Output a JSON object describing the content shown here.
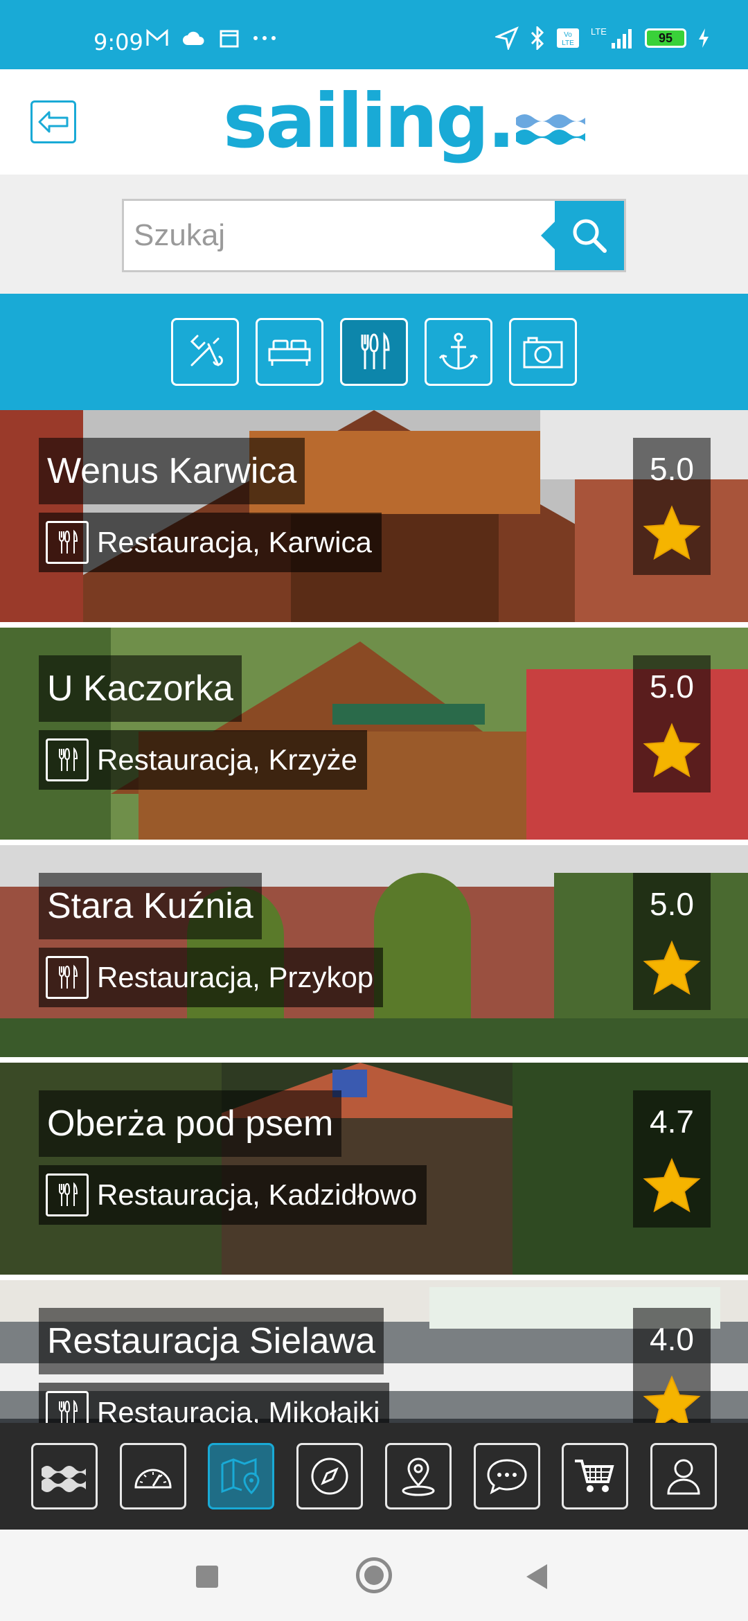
{
  "status": {
    "time": "9:09",
    "battery": "95",
    "network": "LTE",
    "volte": "Vo LTE"
  },
  "header": {
    "logo": "sailing."
  },
  "search": {
    "placeholder": "Szukaj"
  },
  "categories": [
    {
      "icon": "tools-icon",
      "active": false
    },
    {
      "icon": "bed-icon",
      "active": false
    },
    {
      "icon": "cutlery-icon",
      "active": true
    },
    {
      "icon": "anchor-icon",
      "active": false
    },
    {
      "icon": "camera-icon",
      "active": false
    }
  ],
  "places": [
    {
      "name": "Wenus Karwica",
      "subtitle": "Restauracja, Karwica",
      "rating": "5.0",
      "theme": "#7a3b22"
    },
    {
      "name": "U Kaczorka",
      "subtitle": "Restauracja, Krzyże",
      "rating": "5.0",
      "theme": "#8a4a24"
    },
    {
      "name": "Stara Kuźnia",
      "subtitle": "Restauracja, Przykop",
      "rating": "5.0",
      "theme": "#6b3a2a"
    },
    {
      "name": "Oberża pod psem",
      "subtitle": "Restauracja, Kadzidłowo",
      "rating": "4.7",
      "theme": "#3d3324"
    },
    {
      "name": "Restauracja Sielawa",
      "subtitle": "Restauracja, Mikołajki",
      "rating": "4.0",
      "theme": "#5a5f63"
    }
  ],
  "bottom_nav": [
    {
      "icon": "waves-icon",
      "active": false
    },
    {
      "icon": "speedometer-icon",
      "active": false
    },
    {
      "icon": "map-pin-icon",
      "active": true
    },
    {
      "icon": "compass-icon",
      "active": false
    },
    {
      "icon": "location-icon",
      "active": false
    },
    {
      "icon": "chat-icon",
      "active": false
    },
    {
      "icon": "cart-icon",
      "active": false
    },
    {
      "icon": "user-icon",
      "active": false
    }
  ],
  "colors": {
    "brand": "#19aad6",
    "star": "#f5b400"
  }
}
